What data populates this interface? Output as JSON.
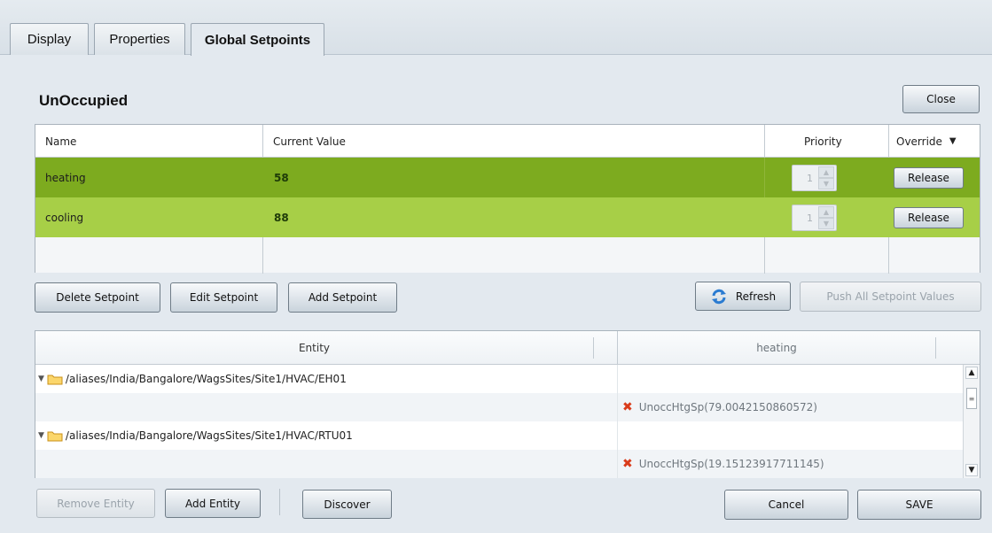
{
  "tabs": [
    {
      "label": "Display"
    },
    {
      "label": "Properties"
    },
    {
      "label": "Global Setpoints"
    }
  ],
  "panel": {
    "title": "UnOccupied",
    "close_label": "Close"
  },
  "setpoints": {
    "columns": {
      "name": "Name",
      "current_value": "Current Value",
      "priority": "Priority",
      "override": "Override",
      "override_icon": "sort-down-icon"
    },
    "rows": [
      {
        "name": "heating",
        "value": "58",
        "priority": "1",
        "override": "Release",
        "row_color": "#7dab1f"
      },
      {
        "name": "cooling",
        "value": "88",
        "priority": "1",
        "override": "Release",
        "row_color": "#a7cf47"
      }
    ]
  },
  "setpoint_actions": {
    "delete": "Delete Setpoint",
    "edit": "Edit Setpoint",
    "add": "Add Setpoint",
    "refresh": "Refresh",
    "push_all": "Push All Setpoint Values"
  },
  "entities": {
    "columns": {
      "entity": "Entity",
      "setpoint": "heating"
    },
    "rows": [
      {
        "path": "/aliases/India/Bangalore/WagsSites/Site1/HVAC/EH01",
        "value": ""
      },
      {
        "path": "",
        "value": "UnoccHtgSp(79.0042150860572)",
        "status_icon": "error-x-icon"
      },
      {
        "path": "/aliases/India/Bangalore/WagsSites/Site1/HVAC/RTU01",
        "value": ""
      },
      {
        "path": "",
        "value": "UnoccHtgSp(19.15123917711145)",
        "status_icon": "error-x-icon"
      }
    ]
  },
  "entity_actions": {
    "remove": "Remove Entity",
    "add": "Add Entity",
    "discover": "Discover",
    "cancel": "Cancel",
    "save": "SAVE"
  },
  "colors": {
    "heating_row": "#7dab1f",
    "cooling_row": "#a7cf47",
    "error_icon": "#d93b1a"
  }
}
